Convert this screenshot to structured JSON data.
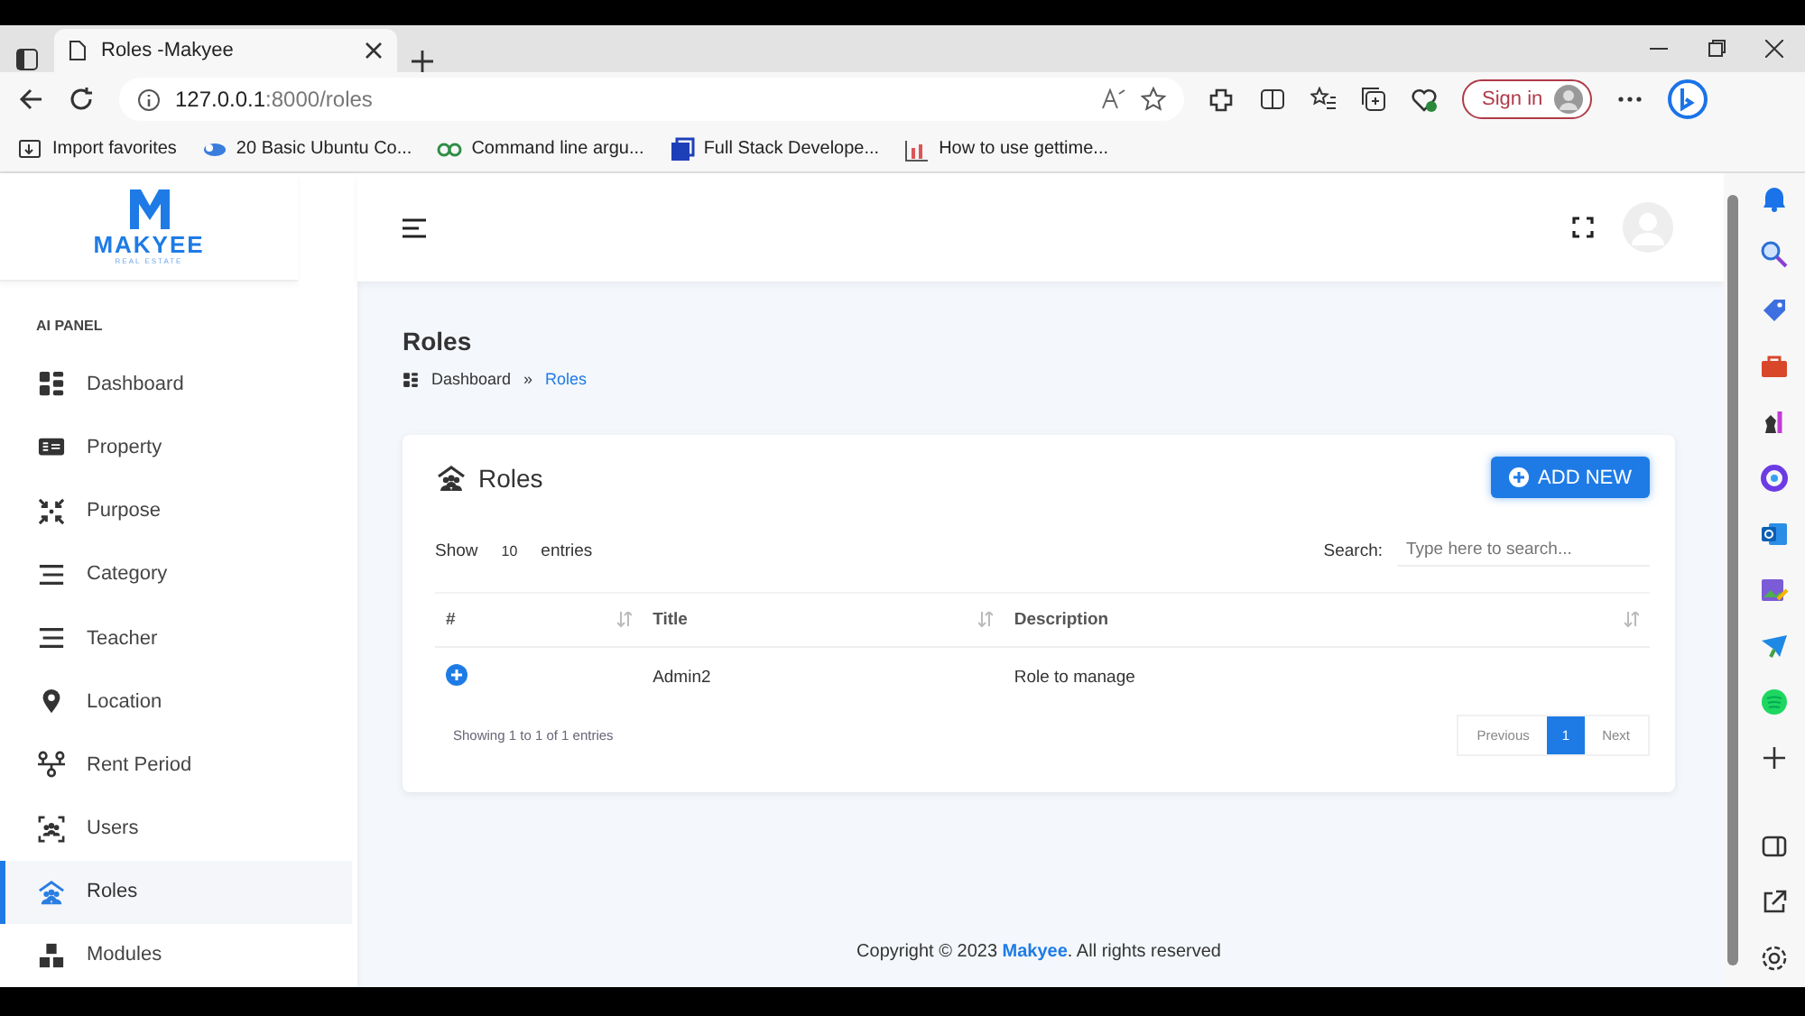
{
  "browser": {
    "tab_title": "Roles -Makyee",
    "url_host": "127.0.0.1",
    "url_path": ":8000/roles",
    "sign_in": "Sign in",
    "bookmarks": [
      {
        "label": "Import favorites",
        "kind": "import"
      },
      {
        "label": "20 Basic Ubuntu Co...",
        "kind": "cloud"
      },
      {
        "label": "Command line argu...",
        "kind": "gg"
      },
      {
        "label": "Full Stack Develope...",
        "kind": "square"
      },
      {
        "label": "How to use gettime...",
        "kind": "chart"
      }
    ]
  },
  "sidebar": {
    "logo": "MAKYEE",
    "logo_sub": "REAL ESTATE",
    "section": "AI PANEL",
    "items": [
      {
        "label": "Dashboard",
        "kind": "grid",
        "selected": false
      },
      {
        "label": "Property",
        "kind": "card",
        "selected": false
      },
      {
        "label": "Purpose",
        "kind": "arrows",
        "selected": false
      },
      {
        "label": "Category",
        "kind": "lines",
        "selected": false
      },
      {
        "label": "Teacher",
        "kind": "lines",
        "selected": false
      },
      {
        "label": "Location",
        "kind": "pin",
        "selected": false
      },
      {
        "label": "Rent Period",
        "kind": "tree",
        "selected": false
      },
      {
        "label": "Users",
        "kind": "users",
        "selected": false
      },
      {
        "label": "Roles",
        "kind": "roles",
        "selected": true
      },
      {
        "label": "Modules",
        "kind": "modules",
        "selected": false
      }
    ]
  },
  "page": {
    "title": "Roles",
    "breadcrumb": [
      {
        "label": "Dashboard",
        "selected": false
      },
      {
        "label": "Roles",
        "selected": true
      }
    ],
    "separator": "»"
  },
  "card": {
    "title": "Roles",
    "add_button": "ADD NEW",
    "show_label": "Show",
    "page_length": "10",
    "entries_label": "entries",
    "search_label": "Search:",
    "search_placeholder": "Type here to search...",
    "columns": [
      "#",
      "Title",
      "Description"
    ],
    "rows": [
      [
        "",
        "Admin2",
        "Role to manage"
      ]
    ],
    "info": "Showing 1 to 1 of 1 entries",
    "pagination": [
      {
        "label": "Previous",
        "selected": false
      },
      {
        "label": "1",
        "selected": true
      },
      {
        "label": "Next",
        "selected": false
      }
    ]
  },
  "footer": "Copyright © 2023 **Makyee**. All rights reserved"
}
